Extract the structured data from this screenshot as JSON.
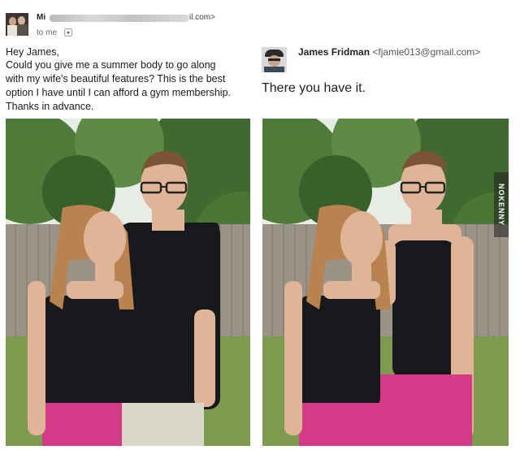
{
  "left_email": {
    "sender_prefix": "Mi",
    "sender_domain": "il.com>",
    "recipient_label": "to me",
    "message_lines": [
      "Hey James,",
      "Could you give me a summer body to go along",
      "with my wife's beautiful features? This is the best",
      "option I have until I can afford a gym membership.",
      "Thanks in advance."
    ]
  },
  "right_email": {
    "sender_name": "James Fridman",
    "sender_email": "<fjamie013@gmail.com>",
    "reply_text": "There you have it."
  },
  "watermark": "NOKENNY",
  "colors": {
    "sky": "#e7ece6",
    "foliage": "#4f7a3a",
    "fence": "#9c9388",
    "grass": "#7e9a4e",
    "shirt_dark": "#17191d",
    "shorts_pink": "#d43b86",
    "skin": "#e0b497",
    "hair_woman": "#b9834f",
    "hair_man": "#7a5434"
  },
  "icons": {
    "left_avatar": "couple-avatar",
    "right_avatar": "profile-avatar",
    "dropdown": "chevron-down-icon"
  }
}
